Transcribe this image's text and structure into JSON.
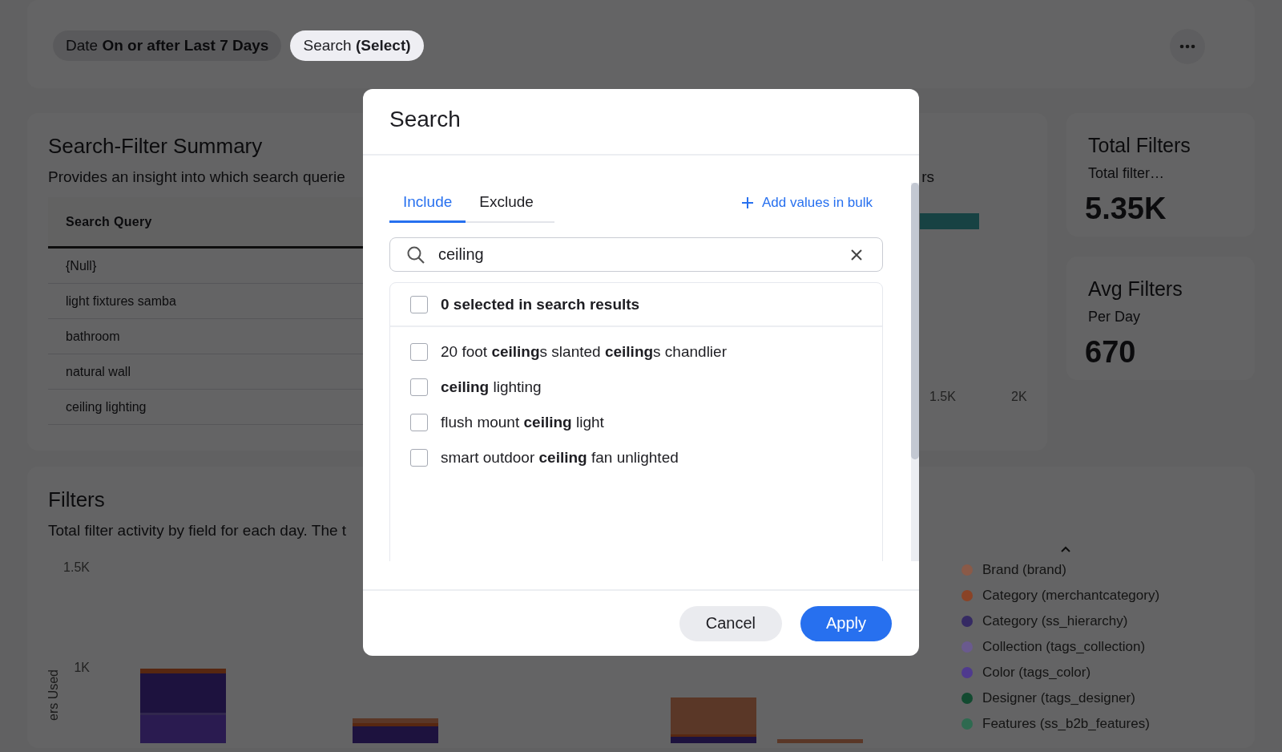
{
  "filter_bar": {
    "chips": [
      {
        "text": "Date **On or after Last 7 Days**",
        "selected": false
      },
      {
        "text": "Search **(Select)**",
        "selected": true
      }
    ]
  },
  "summary": {
    "title": "Search-Filter Summary",
    "subtitle": "Provides an insight into which search querie",
    "subtitle_fragment": "rs",
    "table": {
      "columns": [
        "Search Query"
      ],
      "rows": [
        [
          "{Null}"
        ],
        [
          "light fixtures samba"
        ],
        [
          "bathroom"
        ],
        [
          "natural wall"
        ],
        [
          "ceiling lighting"
        ]
      ]
    },
    "chart": {
      "x_tick_labels": [
        "1.5K",
        "2K"
      ]
    }
  },
  "stats": [
    {
      "title": "Total Filters",
      "subtitle": "Total filter…",
      "value": "5.35K"
    },
    {
      "title": "Avg Filters",
      "subtitle": "Per Day",
      "value": "670"
    }
  ],
  "filters": {
    "title": "Filters",
    "subtitle": "Total filter activity by field for each day. The t",
    "chart": {
      "y_tick_labels": [
        "1.5K",
        "1K"
      ],
      "y_axis_title": "ers Used"
    },
    "legend": [
      {
        "label": "Brand (brand)",
        "color": "#8a5a48"
      },
      {
        "label": "Category (merchantcategory)",
        "color": "#8a4326"
      },
      {
        "label": "Category (ss_hierarchy)",
        "color": "#352a63"
      },
      {
        "label": "Collection (tags_collection)",
        "color": "#6a5a8e"
      },
      {
        "label": "Color (tags_color)",
        "color": "#4f3a8e"
      },
      {
        "label": "Designer (tags_designer)",
        "color": "#124a30"
      },
      {
        "label": "Features (ss_b2b_features)",
        "color": "#2e6a50"
      }
    ]
  },
  "modal": {
    "title": "Search",
    "tabs": [
      {
        "label": "Include",
        "selected": true
      },
      {
        "label": "Exclude",
        "selected": false
      }
    ],
    "bulk_link": "Add values in bulk",
    "search": {
      "value": "ceiling"
    },
    "select_all": {
      "label": "0 selected in search results",
      "checked": false
    },
    "results": [
      {
        "text": "20 foot **ceiling**s slanted **ceiling**s chandlier",
        "checked": false
      },
      {
        "text": "**ceiling** lighting",
        "checked": false
      },
      {
        "text": "flush mount **ceiling** light",
        "checked": false
      },
      {
        "text": "smart outdoor **ceiling** fan unlighted",
        "checked": false
      }
    ],
    "buttons": [
      {
        "label": "Cancel",
        "kind": "secondary"
      },
      {
        "label": "Apply",
        "kind": "primary"
      }
    ]
  }
}
